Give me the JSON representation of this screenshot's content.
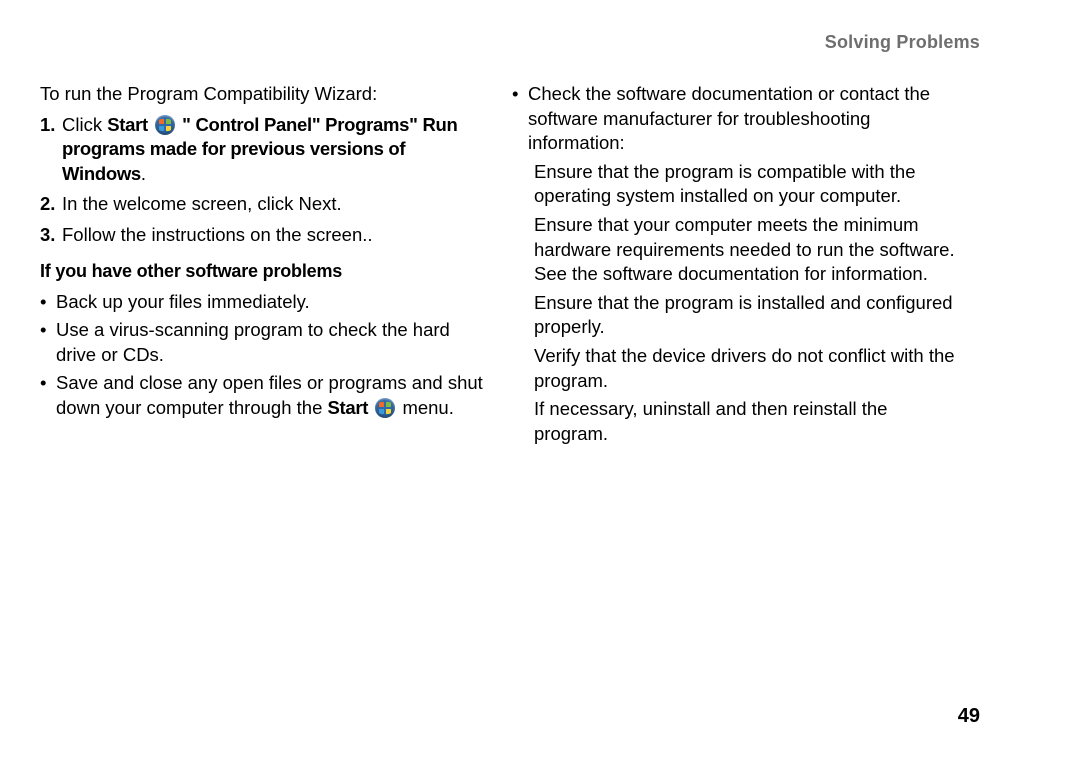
{
  "header": {
    "title": "Solving Problems"
  },
  "left": {
    "intro": "To run the Program Compatibility Wizard:",
    "steps": [
      {
        "num": "1.",
        "prefix": "Click ",
        "boldA": "Start",
        "sep1": "  \"  ",
        "boldB": "Control Panel",
        "tail1": "\" ",
        "boldC": "Programs",
        "sep2": "\"  ",
        "boldD": "Run programs made for previous versions of Windows",
        "period": "."
      },
      {
        "num": "2.",
        "text": "In the welcome screen, click Next."
      },
      {
        "num": "3.",
        "text": "Follow the instructions on the screen.."
      }
    ],
    "subhead": "If you have other software problems",
    "bullets": [
      {
        "text": "Back up your files immediately."
      },
      {
        "text": "Use a virus-scanning program to check the hard drive or CDs."
      },
      {
        "prefix": "Save and close any open files or programs and shut down your computer through the ",
        "bold": "Start",
        "suffix": " menu."
      }
    ]
  },
  "right": {
    "bullets": [
      {
        "text": "Check the software documentation or contact the software manufacturer for troubleshooting information:"
      }
    ],
    "sub": [
      "Ensure that the program is compatible with the operating system installed on your computer.",
      "Ensure that your computer meets the minimum hardware requirements needed to run the software. See the software documentation for information.",
      "Ensure that the program is installed and configured properly.",
      "Verify that the device drivers do not conflict with the program.",
      "If necessary, uninstall and then reinstall the program."
    ]
  },
  "pageNumber": "49"
}
